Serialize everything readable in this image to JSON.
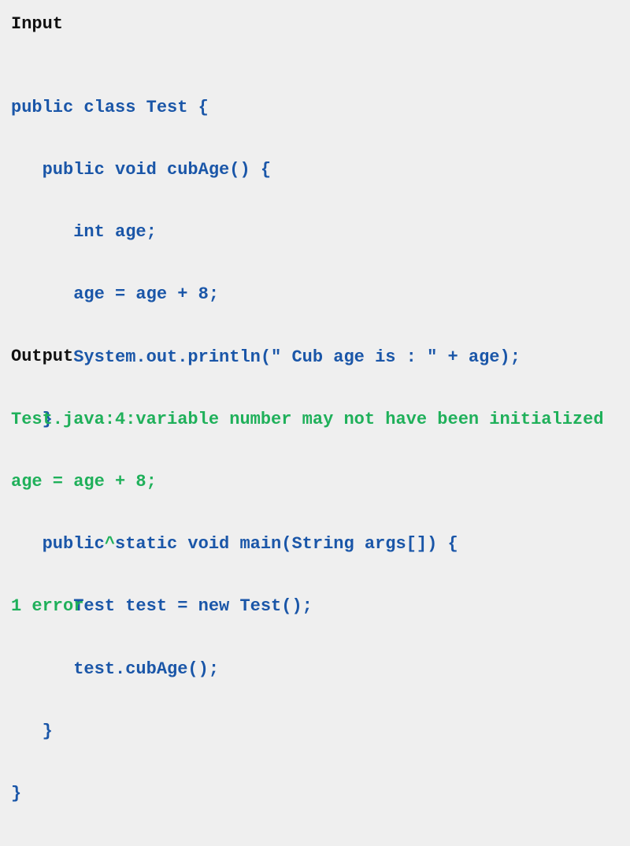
{
  "input": {
    "heading": "Input",
    "code_lines": [
      "public class Test {",
      "   public void cubAge() {",
      "      int age;",
      "      age = age + 8;",
      "      System.out.println(\" Cub age is : \" + age);",
      "   }",
      "",
      "   public static void main(String args[]) {",
      "      Test test = new Test();",
      "      test.cubAge();",
      "   }",
      "}"
    ]
  },
  "output": {
    "heading": "Output",
    "lines": [
      "Test.java:4:variable number may not have been initialized",
      "age = age + 8;",
      "         ^",
      "1 error"
    ]
  },
  "colors": {
    "background": "#efefef",
    "heading": "#111111",
    "code": "#1a56a8",
    "output": "#1fb05a"
  }
}
